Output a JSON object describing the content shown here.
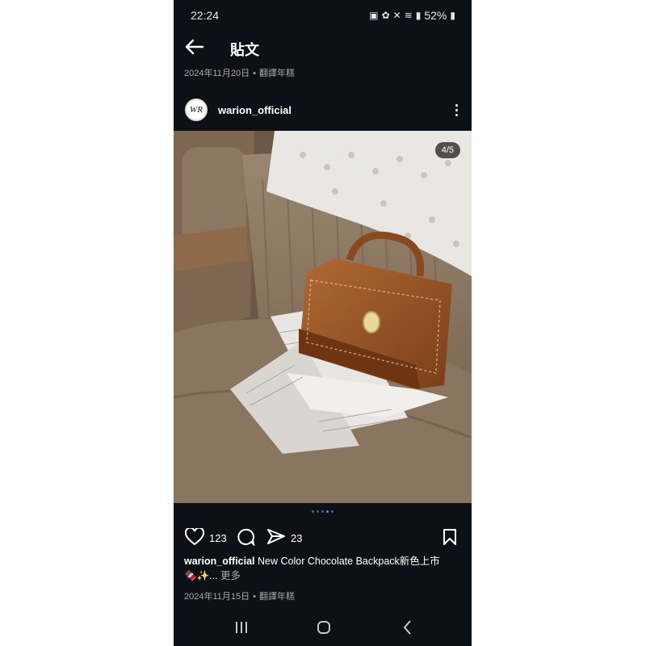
{
  "status_bar": {
    "time": "22:24",
    "battery": "52%"
  },
  "header": {
    "title": "貼文"
  },
  "post_meta_top": {
    "date": "2024年11月20日",
    "translate": "翻譯年糕"
  },
  "author": {
    "avatar_text": "WR",
    "username": "warion_official"
  },
  "media": {
    "counter": "4/5",
    "slide_count": 5,
    "active_slide": 4
  },
  "actions": {
    "likes": "123",
    "shares": "23"
  },
  "caption": {
    "username": "warion_official",
    "text": "New Color Chocolate Backpack新色上市",
    "emoji_line": "🍫✨...",
    "more": "更多"
  },
  "post_meta_bottom": {
    "date": "2024年11月15日",
    "translate": "翻譯年糕"
  },
  "icons": [
    "back-arrow-icon",
    "more-options-icon",
    "heart-icon",
    "comment-icon",
    "share-icon",
    "bookmark-icon",
    "recent-apps-icon",
    "home-icon",
    "back-icon"
  ],
  "colors": {
    "background": "#0d1117",
    "accent": "#3b8ff0"
  }
}
